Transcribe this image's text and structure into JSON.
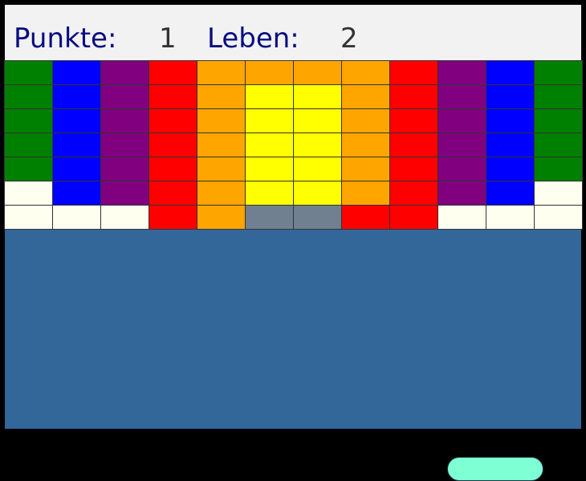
{
  "hud": {
    "score_label": "Punkte:",
    "score_value": "1",
    "lives_label": "Leben:",
    "lives_value": "2"
  },
  "colors": {
    "G": "#008000",
    "B": "#0000ff",
    "P": "#800080",
    "R": "#ff0000",
    "O": "#ffa500",
    "Y": "#ffff00",
    "W": "#fffff0",
    "S": "#708090"
  },
  "bricks": [
    [
      "G",
      "B",
      "P",
      "R",
      "O",
      "O",
      "O",
      "O",
      "R",
      "P",
      "B",
      "G"
    ],
    [
      "G",
      "B",
      "P",
      "R",
      "O",
      "Y",
      "Y",
      "O",
      "R",
      "P",
      "B",
      "G"
    ],
    [
      "G",
      "B",
      "P",
      "R",
      "O",
      "Y",
      "Y",
      "O",
      "R",
      "P",
      "B",
      "G"
    ],
    [
      "G",
      "B",
      "P",
      "R",
      "O",
      "Y",
      "Y",
      "O",
      "R",
      "P",
      "B",
      "G"
    ],
    [
      "G",
      "B",
      "P",
      "R",
      "O",
      "Y",
      "Y",
      "O",
      "R",
      "P",
      "B",
      "G"
    ],
    [
      "W",
      "B",
      "P",
      "R",
      "O",
      "Y",
      "Y",
      "O",
      "R",
      "P",
      "B",
      "W"
    ],
    [
      "W",
      "W",
      "W",
      "R",
      "O",
      "S",
      "S",
      "R",
      "R",
      "W",
      "W",
      "W"
    ]
  ]
}
